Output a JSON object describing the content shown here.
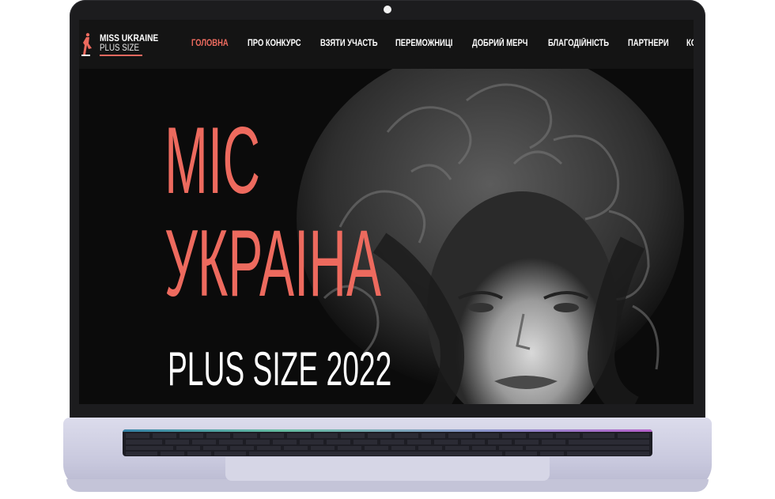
{
  "device": "laptop",
  "site": {
    "logo": {
      "title": "MISS UKRAINE",
      "subtitle": "PLUS SIZE"
    },
    "nav": {
      "items": [
        {
          "label": "ГОЛОВНА",
          "active": true
        },
        {
          "label": "ПРО КОНКУРС",
          "active": false
        },
        {
          "label": "ВЗЯТИ УЧАСТЬ",
          "active": false
        },
        {
          "label": "ПЕРЕМОЖНИЦІ",
          "active": false
        },
        {
          "label": "ДОБРИЙ МЕРЧ",
          "active": false
        },
        {
          "label": "БЛАГОДІЙНІСТЬ",
          "active": false
        },
        {
          "label": "ПАРТНЕРИ",
          "active": false
        },
        {
          "label": "КО",
          "active": false
        }
      ]
    },
    "hero": {
      "title_line1": "МІС",
      "title_line2": "УКРАІНА",
      "subtitle": "PLUS SIZE 2022"
    }
  },
  "colors": {
    "accent": "#ed6a5e",
    "background": "#0b0b0b",
    "nav_background": "#141414",
    "text": "#ffffff"
  }
}
